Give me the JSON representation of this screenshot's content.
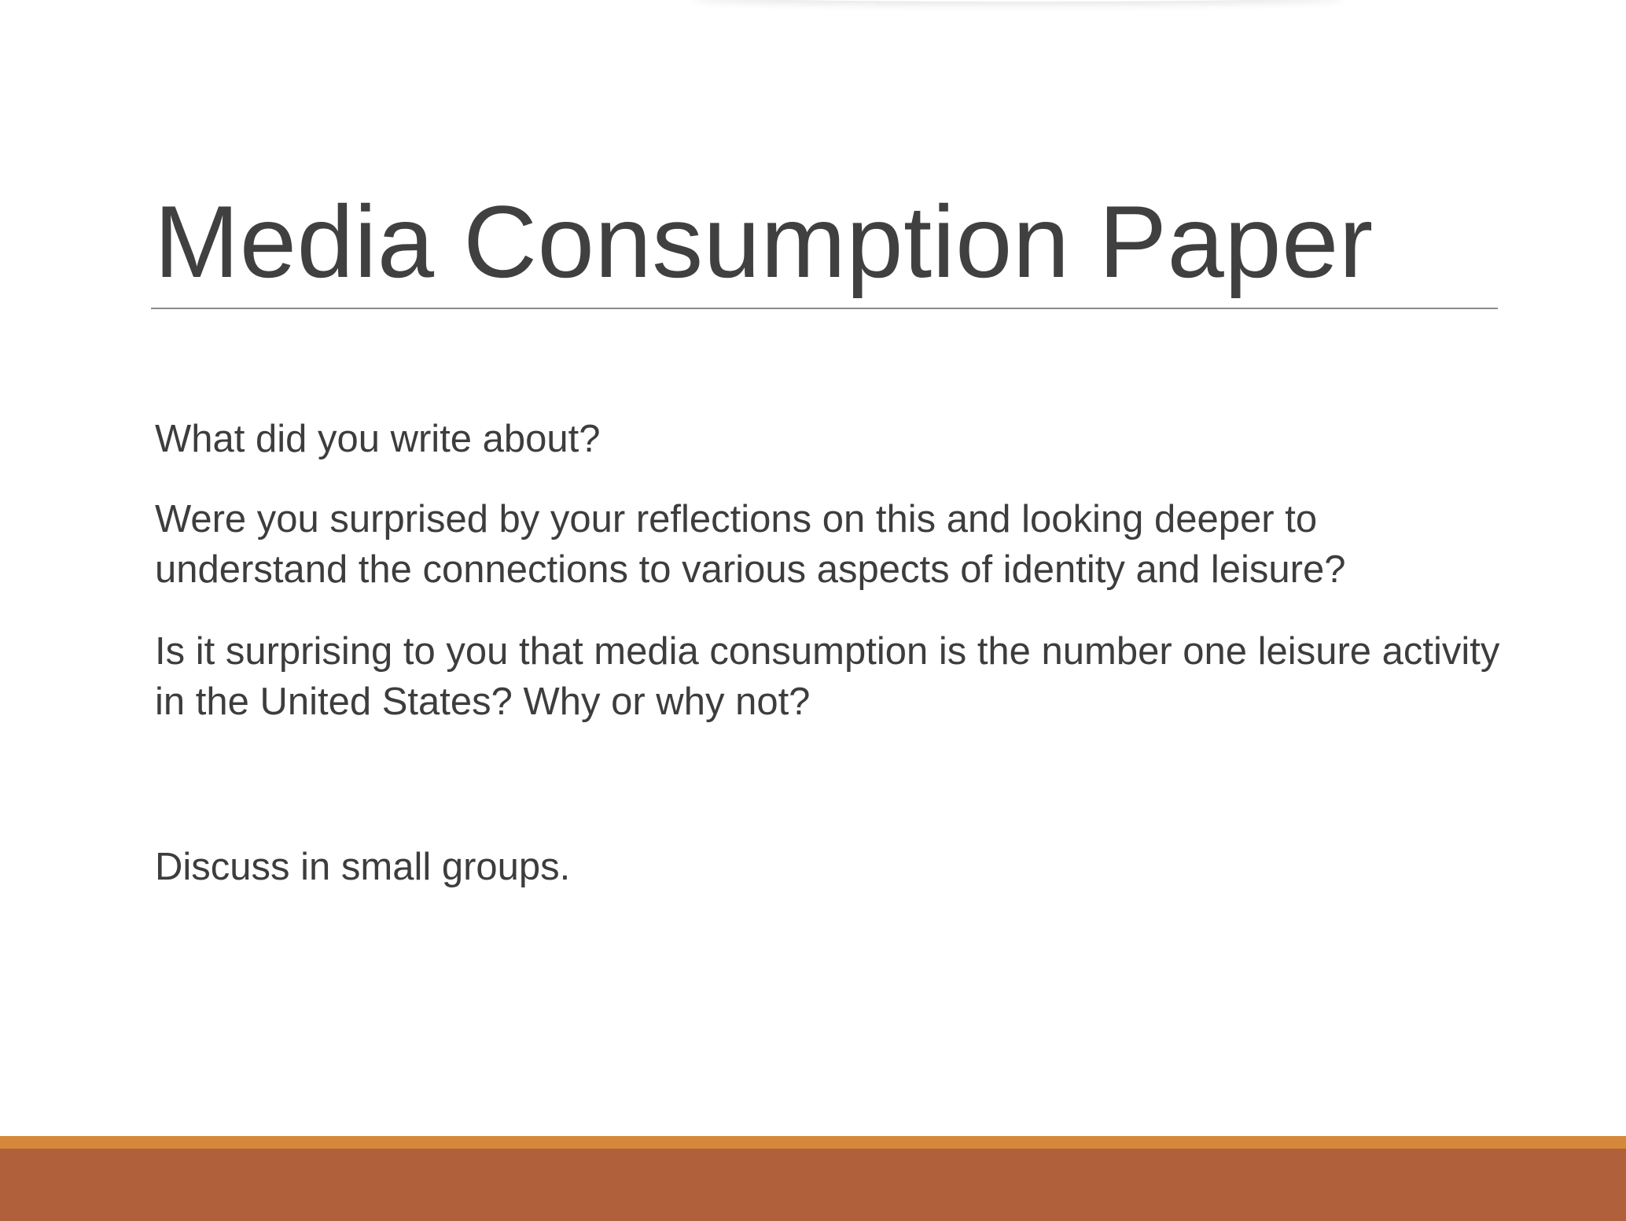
{
  "slide": {
    "title": "Media Consumption Paper",
    "paragraphs": [
      "What did you write about?",
      "Were you surprised by your reflections on this and looking deeper to understand the connections to various aspects of identity and leisure?",
      "Is it surprising to you that media consumption is the number one leisure activity in the United States? Why or why not?",
      "Discuss in small groups."
    ]
  },
  "colors": {
    "footer_accent": "#d6883a",
    "footer_band": "#b0603a",
    "text": "#3d3d3d",
    "rule": "#8c8c8c"
  }
}
